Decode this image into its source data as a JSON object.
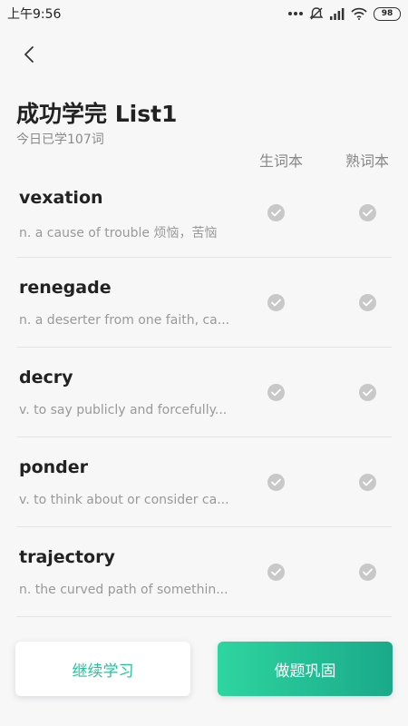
{
  "status_bar": {
    "time": "上午9:56",
    "battery": "98",
    "icons": [
      "dots-icon",
      "mute-alarm-icon",
      "signal-icon",
      "wifi-icon",
      "battery-icon"
    ]
  },
  "header": {
    "back_icon": "chevron-left-icon",
    "title": "成功学完 List1",
    "subtitle": "今日已学107词"
  },
  "columns": {
    "new_words": "生词本",
    "known_words": "熟词本"
  },
  "words": [
    {
      "word": "vexation",
      "definition": "n. a cause of trouble 烦恼，苦恼"
    },
    {
      "word": "renegade",
      "definition": "n. a deserter from one faith, ca..."
    },
    {
      "word": "decry",
      "definition": "v. to say publicly and forcefully..."
    },
    {
      "word": "ponder",
      "definition": "v. to think about or consider ca..."
    },
    {
      "word": "trajectory",
      "definition": "n. the curved path of somethin..."
    }
  ],
  "buttons": {
    "continue": "继续学习",
    "practice": "做题巩固"
  },
  "colors": {
    "accent": "#22c59a",
    "gradient_start": "#2ed59f",
    "gradient_end": "#1aa98a"
  }
}
